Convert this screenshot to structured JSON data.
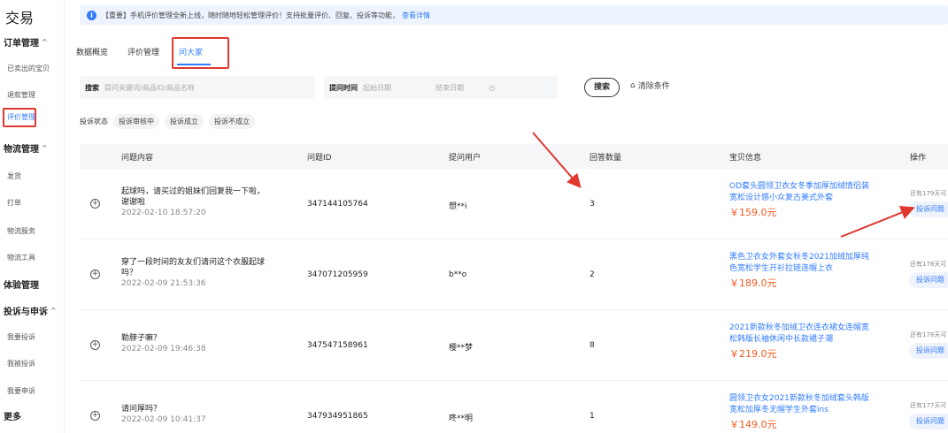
{
  "sidebar": {
    "title": "交易",
    "groups": [
      {
        "label": "订单管理",
        "caret": "^",
        "items": [
          "已卖出的宝贝",
          "退款管理",
          "评价管理"
        ]
      },
      {
        "label": "物流管理",
        "caret": "^",
        "items": [
          "发货",
          "打单",
          "物流服务",
          "物流工具"
        ]
      },
      {
        "label": "体验管理",
        "caret": "",
        "items": []
      },
      {
        "label": "投诉与申诉",
        "caret": "^",
        "items": [
          "我要投诉",
          "我被投诉",
          "我要申诉"
        ]
      },
      {
        "label": "更多",
        "caret": "",
        "items": []
      }
    ],
    "active_item": "评价管理"
  },
  "notice": {
    "text": "【重要】手机评价管理全新上线，随时随地轻松管理评价！支持批量评价、回复、投诉等功能，",
    "link": "查看详情"
  },
  "tabs": [
    "数据概览",
    "评价管理",
    "问大家"
  ],
  "active_tab": "问大家",
  "filters": {
    "search_label": "搜索",
    "search_placeholder": "提问关键词/商品ID/商品名称",
    "time_label": "提问时间",
    "start_placeholder": "起始日期",
    "end_placeholder": "结束日期",
    "search_button": "搜索",
    "clear_button": "清除条件"
  },
  "status": {
    "label": "投诉状态",
    "chips": [
      "投诉审核中",
      "投诉成立",
      "投诉不成立"
    ]
  },
  "table": {
    "headers": [
      "问题内容",
      "问题ID",
      "提问用户",
      "回答数量",
      "宝贝信息",
      "操作"
    ],
    "rows": [
      {
        "question": "起球吗，请买过的姐妹们回复我一下啦，谢谢啦",
        "date": "2022-02-10 18:57:20",
        "id": "347144105764",
        "user": "想**i",
        "answers": "3",
        "item": "OD套头圆领卫衣女冬季加厚加绒情侣装宽松设计感小众复古美式外套",
        "price": "￥159.0元",
        "days": "还有179天可",
        "action": "投诉问题"
      },
      {
        "question": "穿了一段时间的友友们请问这个衣服起球吗？",
        "date": "2022-02-09 21:53:36",
        "id": "347071205959",
        "user": "b**o",
        "answers": "2",
        "item": "黑色卫衣女外套女秋冬2021加绒加厚纯色宽松学生开衫拉链连帽上衣",
        "price": "￥189.0元",
        "days": "还有178天可",
        "action": "投诉问题"
      },
      {
        "question": "勒脖子嘛？",
        "date": "2022-02-09 19:46:38",
        "id": "347547158961",
        "user": "樱**梦",
        "answers": "8",
        "item": "2021新款秋冬加绒卫衣连衣裙女连帽宽松韩版长袖休闲中长款裙子潮",
        "price": "￥219.0元",
        "days": "还有178天可",
        "action": "投诉问题"
      },
      {
        "question": "请问厚吗？",
        "date": "2022-02-09 10:41:37",
        "id": "347934951865",
        "user": "咚**明",
        "answers": "1",
        "item": "圆领卫衣女2021新款秋冬加绒套头韩版宽松加厚冬无帽学生外套ins",
        "price": "￥149.0元",
        "days": "还有177天可",
        "action": "投诉问题"
      }
    ]
  },
  "colors": {
    "accent": "#2f7bff",
    "highlight": "#e0372e",
    "price": "#f25a22"
  }
}
